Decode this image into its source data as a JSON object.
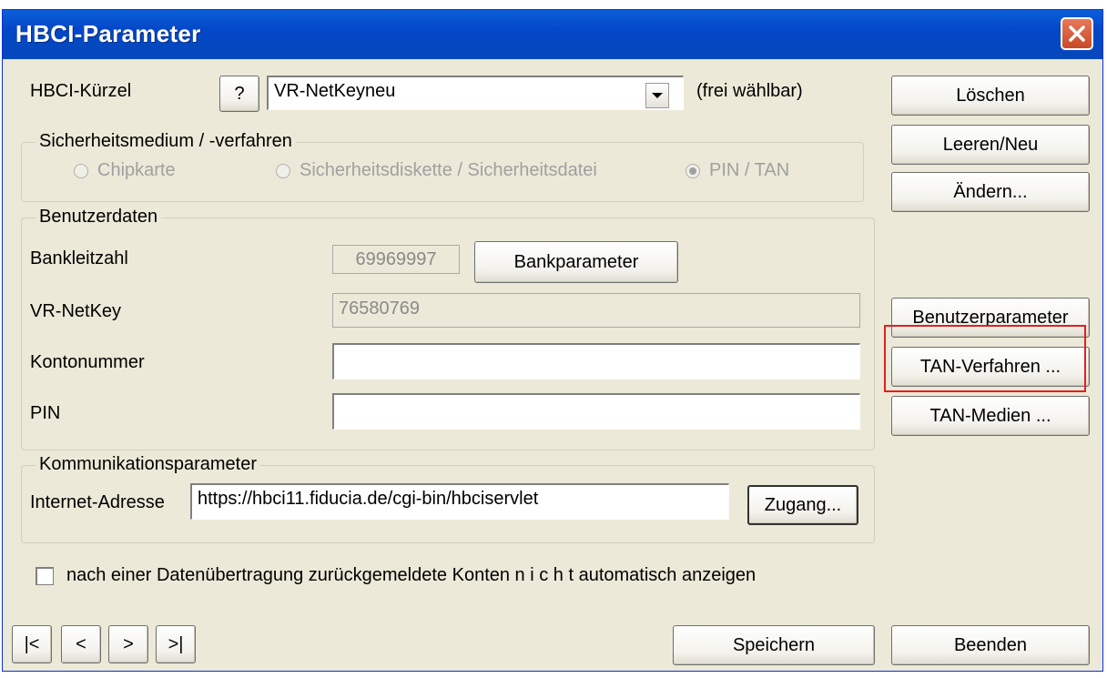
{
  "window": {
    "title": "HBCI-Parameter"
  },
  "hbci": {
    "label": "HBCI-Kürzel",
    "help_label": "?",
    "value": "VR-NetKeyneu",
    "hint": "(frei wählbar)"
  },
  "security": {
    "title": "Sicherheitsmedium / -verfahren",
    "options": [
      "Chipkarte",
      "Sicherheitsdiskette / Sicherheitsdatei",
      "PIN / TAN"
    ],
    "selected": "PIN / TAN"
  },
  "user": {
    "title": "Benutzerdaten",
    "blz_label": "Bankleitzahl",
    "blz_value": "69969997",
    "bankparam_label": "Bankparameter",
    "netkey_label": "VR-NetKey",
    "netkey_value": "76580769",
    "konto_label": "Kontonummer",
    "konto_value": "",
    "pin_label": "PIN",
    "pin_value": ""
  },
  "comm": {
    "title": "Kommunikationsparameter",
    "inet_label": "Internet-Adresse",
    "inet_value": "https://hbci11.fiducia.de/cgi-bin/hbciservlet",
    "zugang_label": "Zugang..."
  },
  "option": {
    "label": "nach einer Datenübertragung zurückgemeldete Konten  n i c h t  automatisch anzeigen",
    "checked": false
  },
  "right_buttons": {
    "loeschen": "Löschen",
    "leeren": "Leeren/Neu",
    "aendern": "Ändern...",
    "benutzer": "Benutzerparameter",
    "tan_verfahren": "TAN-Verfahren ...",
    "tan_medien": "TAN-Medien ..."
  },
  "nav": {
    "first": "|<",
    "prev": "<",
    "next": ">",
    "last": ">|"
  },
  "bottom": {
    "speichern": "Speichern",
    "beenden": "Beenden"
  },
  "colors": {
    "highlight": "#e02020",
    "titlebar": "#0548ba"
  }
}
